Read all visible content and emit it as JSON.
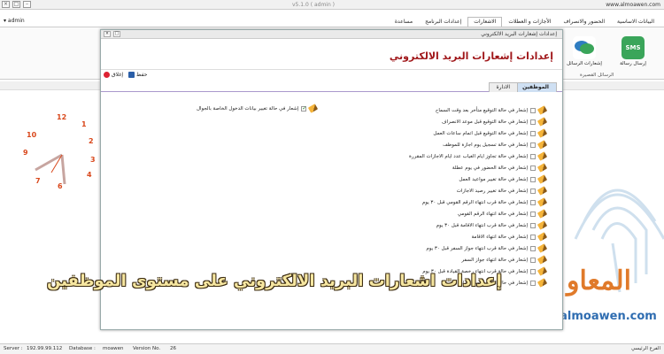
{
  "titlebar": {
    "url": "www.almoawen.com",
    "app": "v5.1.0 ( admin )"
  },
  "menubar": {
    "user": "admin",
    "menus": [
      "البيانات الاساسية",
      "الحضور والانصراف",
      "الأجازات و العطلات",
      "الاشعارات",
      "إعدادات البرنامج",
      "مساعدة"
    ],
    "active_index": 3
  },
  "ribbon": {
    "sms_label": "إرسال رسالة",
    "chat_label": "إشعارات الرسائل",
    "group_label": "الرسائل القصيرة"
  },
  "dialog": {
    "title": "إعدادات إشعارات البريد الالكتروني",
    "heading": "إعدادات إشعارات البريد الالكتروني",
    "save": "حفظ",
    "close": "إغلاق",
    "tabs": [
      "الموظفين",
      "الادارة"
    ],
    "active_tab": 0,
    "right_items": [
      {
        "label": "إشعار في حالة التوقيع متأخر بعد وقت السماح",
        "checked": false
      },
      {
        "label": "إشعار في حالة التوقيع قبل موعد الانصراف",
        "checked": false
      },
      {
        "label": "إشعار في حالة التوقيع قبل اتمام ساعات العمل",
        "checked": false
      },
      {
        "label": "إشعار في حالة تسجيل يوم اجازة للموظف",
        "checked": false
      },
      {
        "label": "إشعار في حالة تجاوز ايام الغياب عدد ايام الاجازات المقررة",
        "checked": false
      },
      {
        "label": "إشعار في حالة الحضور في يوم عطلة",
        "checked": false
      },
      {
        "label": "إشعار في حالة تغيير مواعيد العمل",
        "checked": false
      },
      {
        "label": "إشعار في حالة تغيير رصيد الاجازات",
        "checked": false
      },
      {
        "label": "إشعار في حالة قرب انتهاء الرقم القومي قبل ٣٠ يوم",
        "checked": false
      },
      {
        "label": "إشعار في حالة انتهاء الرقم القومي",
        "checked": false
      },
      {
        "label": "إشعار في حالة قرب انتهاء الاقامة قبل ٣٠ يوم",
        "checked": false
      },
      {
        "label": "إشعار في حالة انتهاء الاقامة",
        "checked": false
      },
      {
        "label": "إشعار في حالة قرب انتهاء جواز السفر قبل ٣٠ يوم",
        "checked": false
      },
      {
        "label": "إشعار في حالة انتهاء جواز السفر",
        "checked": false
      },
      {
        "label": "إشعار في حالة قرب انتهاء رخصة القيادة قبل ٣٠ يوم",
        "checked": false
      },
      {
        "label": "إشعار في حالة انتهاء رخصة القيادة",
        "checked": false
      }
    ],
    "left_item": {
      "label": "إشعار في حالة تغيير بيانات الدخول الخاصة بالجوال",
      "checked": true
    }
  },
  "clock": {
    "numbers": [
      "12",
      "1",
      "2",
      "3",
      "4",
      "5",
      "6",
      "7",
      "8",
      "9",
      "10",
      "11"
    ]
  },
  "watermark": "إعدادات اشعارات البريد الالكتروني على مستوى الموظفين",
  "logo": {
    "text": "المعاو",
    "url": "www.almoawen.com"
  },
  "status": {
    "server_label": "Server :",
    "server": "192.99.99.112",
    "db_label": "Database :",
    "db": "moawen",
    "version_label": "Version No.",
    "version": "26",
    "branch": "الفرع الرئيسي"
  },
  "colors": {
    "accent": "#a0171a",
    "clock": "#d9481c",
    "logo": "#e07a2a",
    "url": "#2f6db1"
  }
}
